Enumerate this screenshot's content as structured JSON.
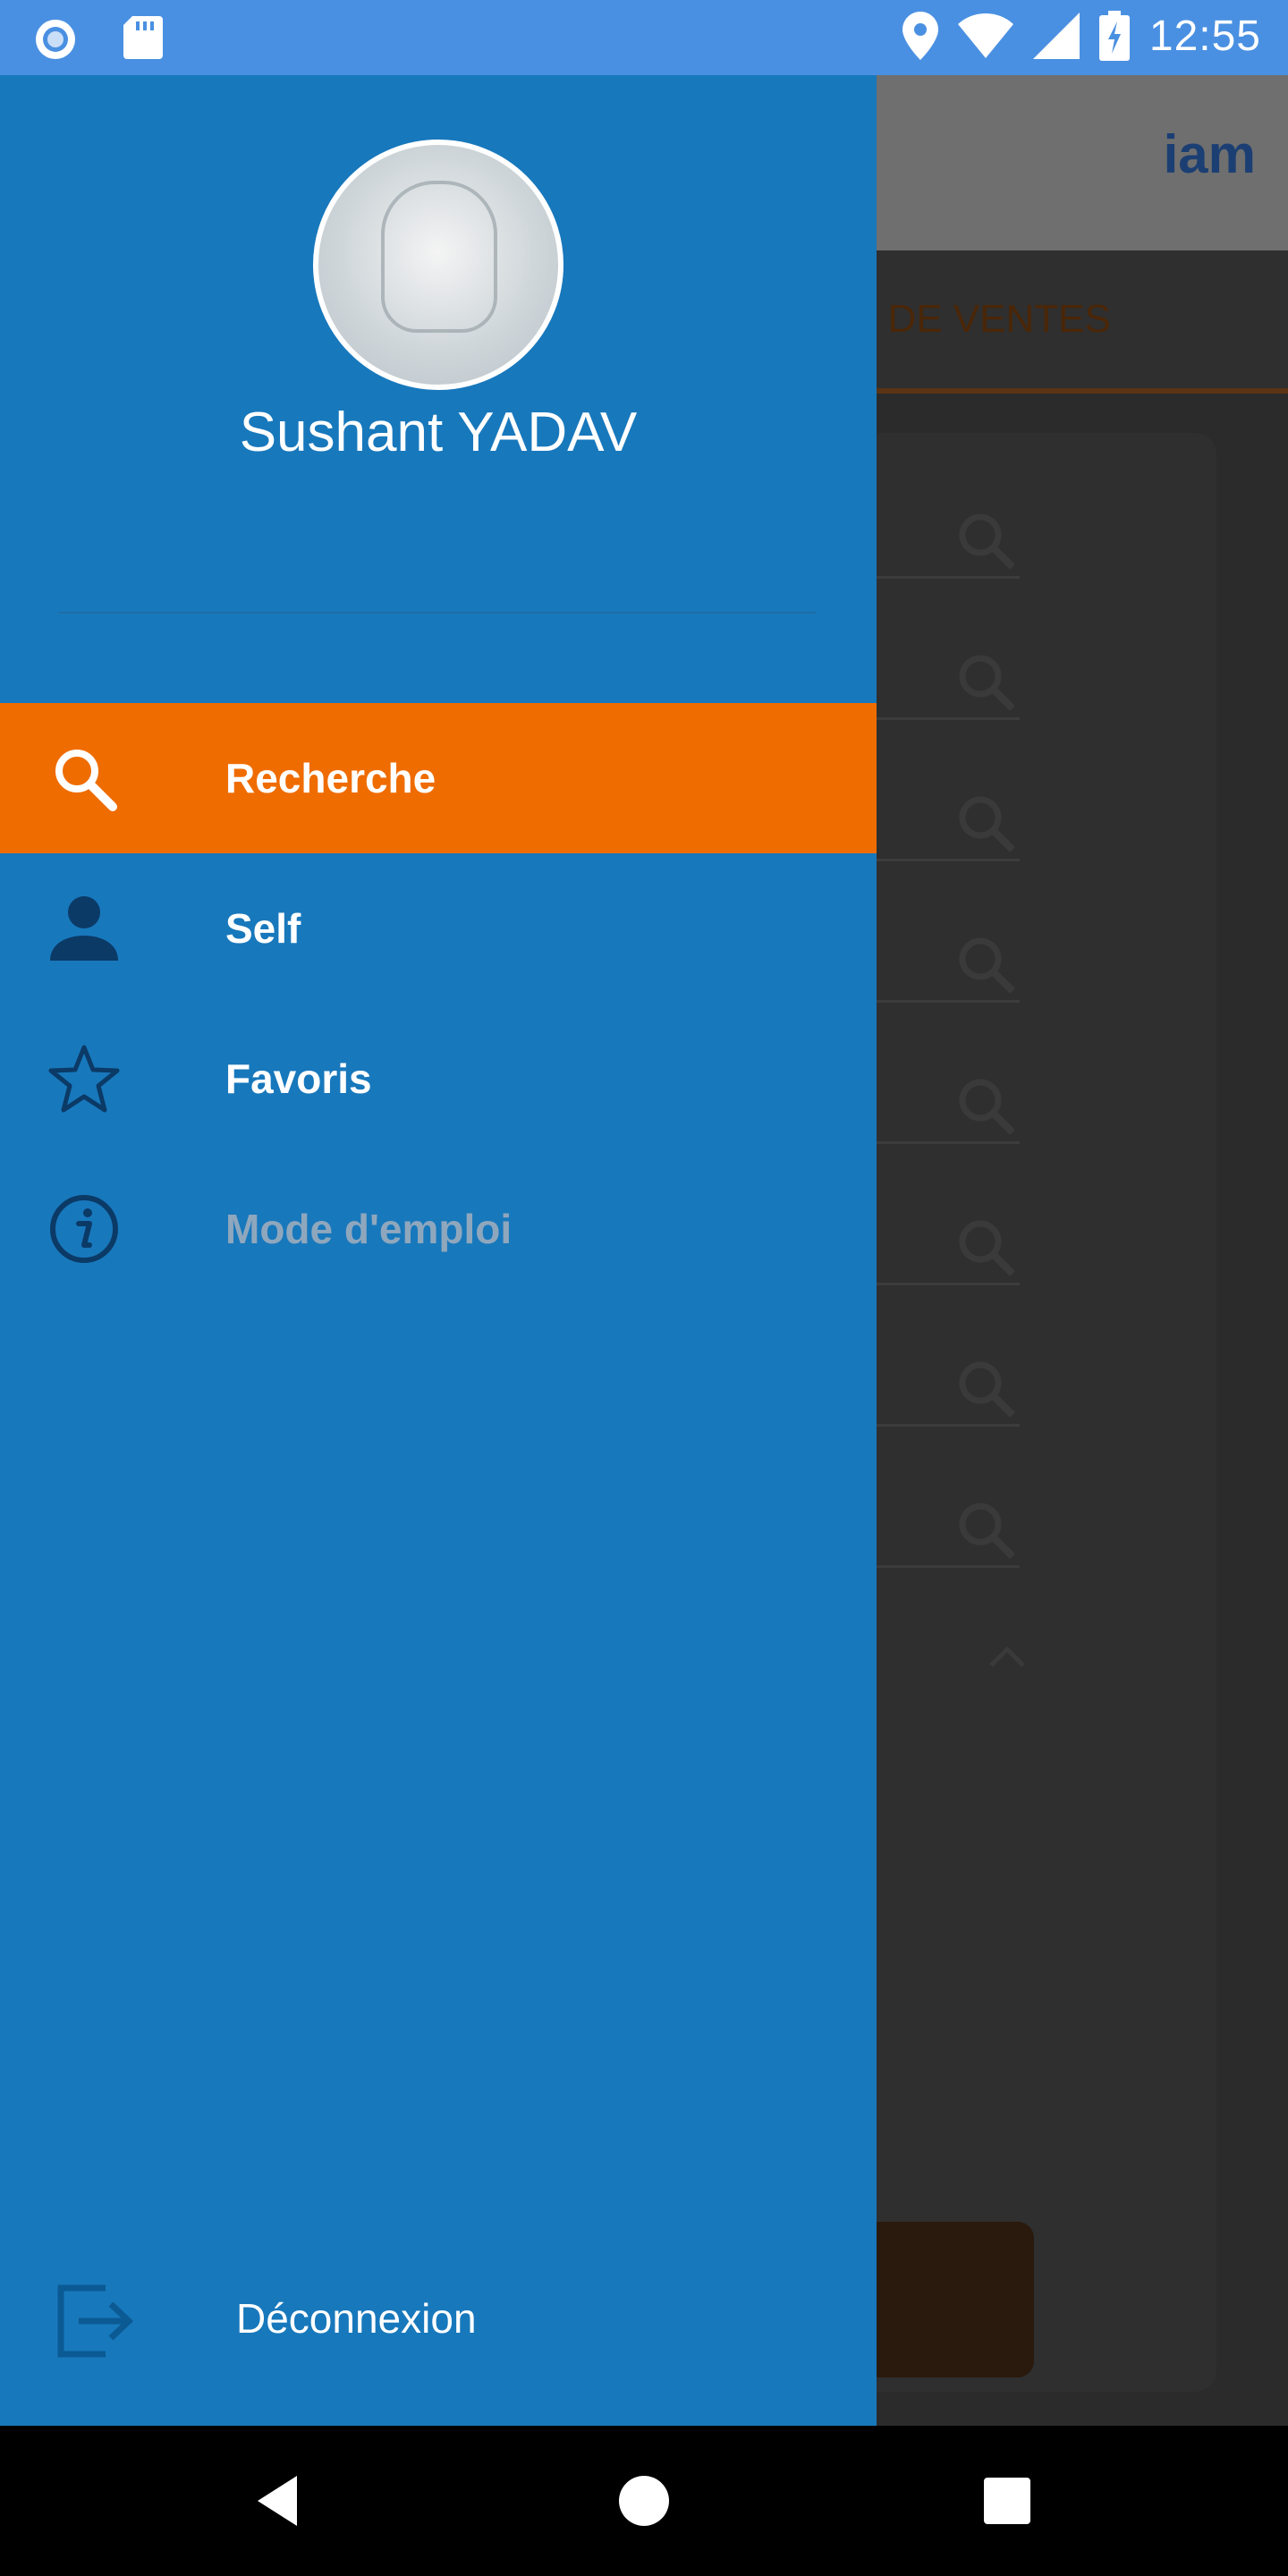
{
  "status_bar": {
    "time": "12:55",
    "icons": [
      "notification-circle-icon",
      "sd-card-icon",
      "location-icon",
      "wifi-icon",
      "cellular-signal-icon",
      "battery-charging-icon"
    ]
  },
  "background_app": {
    "logo": "iam",
    "tab_label": "INTS DE VENTES"
  },
  "drawer": {
    "user_name": "Sushant YADAV",
    "menu": [
      {
        "label": "Recherche",
        "icon": "search-icon",
        "active": true
      },
      {
        "label": "Self",
        "icon": "person-icon",
        "active": false
      },
      {
        "label": "Favoris",
        "icon": "star-icon",
        "active": false
      },
      {
        "label": "Mode d'emploi",
        "icon": "info-icon",
        "active": false,
        "disabled": true
      }
    ],
    "logout_label": "Déconnexion"
  },
  "colors": {
    "drawer_bg": "#1878bc",
    "active_bg": "#ef6c00",
    "status_bar": "#4a90e2",
    "icon_dark": "#0b3a66"
  },
  "nav_bar": {
    "buttons": [
      "back-icon",
      "home-icon",
      "recents-icon"
    ]
  }
}
